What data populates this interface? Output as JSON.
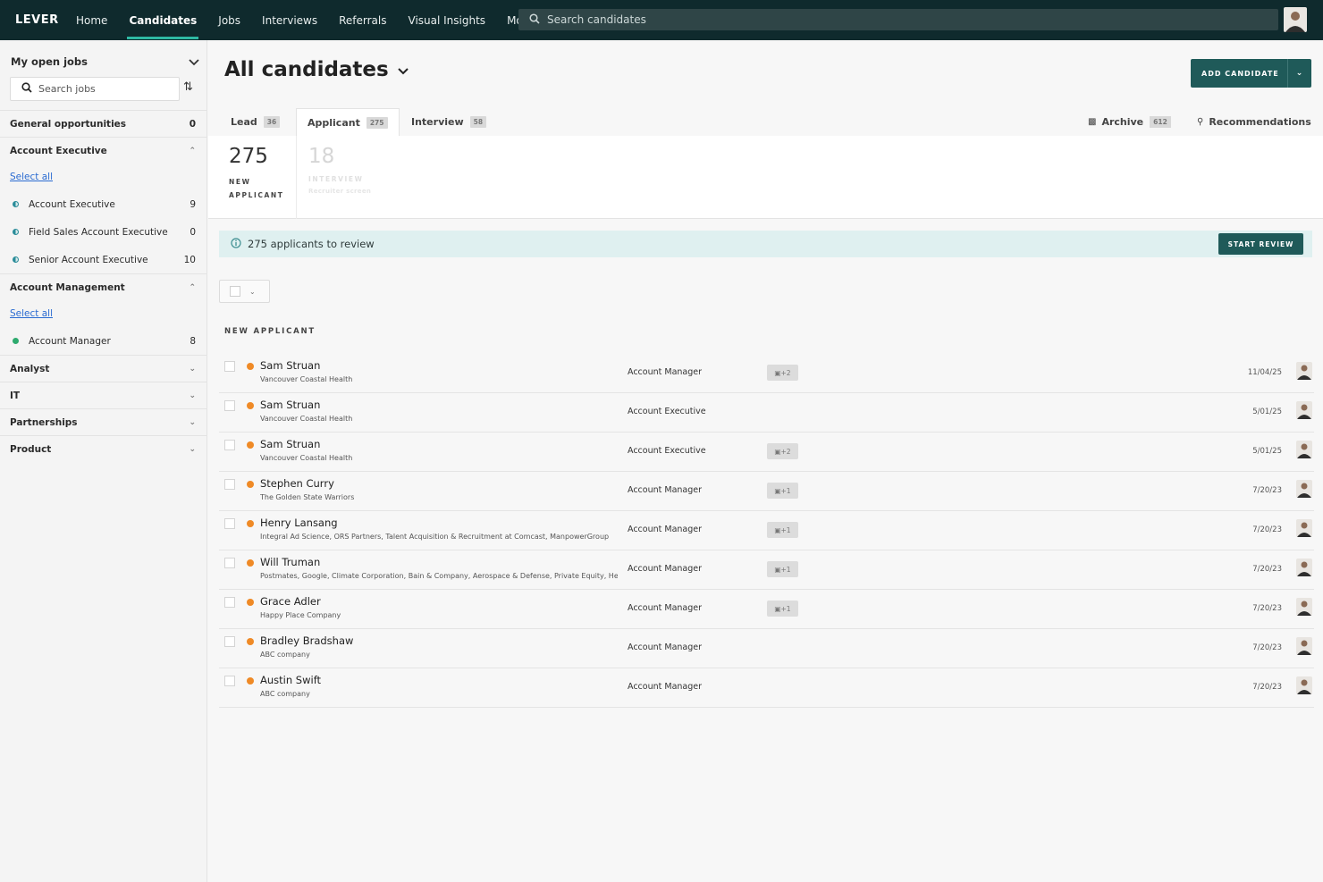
{
  "nav": {
    "logo": "LEVER",
    "items": [
      {
        "label": "Home",
        "active": false
      },
      {
        "label": "Candidates",
        "active": true
      },
      {
        "label": "Jobs",
        "active": false
      },
      {
        "label": "Interviews",
        "active": false
      },
      {
        "label": "Referrals",
        "active": false
      },
      {
        "label": "Visual Insights",
        "active": false
      },
      {
        "label": "More",
        "active": false
      }
    ],
    "search_placeholder": "Search candidates"
  },
  "sidebar": {
    "title": "My open jobs",
    "search_placeholder": "Search jobs",
    "groups": [
      {
        "label": "General opportunities",
        "count": "0",
        "type": "count"
      },
      {
        "label": "Account Executive",
        "type": "expanded",
        "select_all": "Select all",
        "jobs": [
          {
            "label": "Account Executive",
            "count": "9",
            "dot": "half"
          },
          {
            "label": "Field Sales Account Executive",
            "count": "0",
            "dot": "half"
          },
          {
            "label": "Senior Account Executive",
            "count": "10",
            "dot": "half"
          }
        ]
      },
      {
        "label": "Account Management",
        "type": "expanded",
        "select_all": "Select all",
        "jobs": [
          {
            "label": "Account Manager",
            "count": "8",
            "dot": "green"
          }
        ]
      },
      {
        "label": "Analyst",
        "type": "collapsed"
      },
      {
        "label": "IT",
        "type": "collapsed"
      },
      {
        "label": "Partnerships",
        "type": "collapsed"
      },
      {
        "label": "Product",
        "type": "collapsed"
      }
    ]
  },
  "main": {
    "title": "All candidates",
    "add_candidate": "ADD CANDIDATE",
    "tabs": [
      {
        "label": "Lead",
        "count": "36"
      },
      {
        "label": "Applicant",
        "count": "275"
      },
      {
        "label": "Interview",
        "count": "58"
      }
    ],
    "archive": {
      "label": "Archive",
      "count": "612"
    },
    "recommendations": "Recommendations",
    "stages": [
      {
        "num": "275",
        "line1": "NEW",
        "line2": "APPLICANT"
      },
      {
        "num": "18",
        "line1": "INTERVIEW",
        "line2": "Recruiter screen"
      }
    ],
    "banner": "275 applicants to review",
    "start_review": "START REVIEW",
    "section": "NEW APPLICANT",
    "candidates": [
      {
        "name": "Sam Struan",
        "org": "Vancouver Coastal Health",
        "position": "Account Manager",
        "badge": "+2",
        "date": "11/04/25"
      },
      {
        "name": "Sam Struan",
        "org": "Vancouver Coastal Health",
        "position": "Account Executive",
        "badge": "",
        "date": "5/01/25"
      },
      {
        "name": "Sam Struan",
        "org": "Vancouver Coastal Health",
        "position": "Account Executive",
        "badge": "+2",
        "date": "5/01/25"
      },
      {
        "name": "Stephen Curry",
        "org": "The Golden State Warriors",
        "position": "Account Manager",
        "badge": "+1",
        "date": "7/20/23"
      },
      {
        "name": "Henry Lansang",
        "org": "Integral Ad Science, ORS Partners, Talent Acquisition & Recruitment at Comcast, ManpowerGroup",
        "position": "Account Manager",
        "badge": "+1",
        "date": "7/20/23"
      },
      {
        "name": "Will Truman",
        "org": "Postmates, Google, Climate Corporation, Bain & Company, Aerospace & Defense, Private Equity, He...",
        "position": "Account Manager",
        "badge": "+1",
        "date": "7/20/23"
      },
      {
        "name": "Grace Adler",
        "org": "Happy Place Company",
        "position": "Account Manager",
        "badge": "+1",
        "date": "7/20/23"
      },
      {
        "name": "Bradley Bradshaw",
        "org": "ABC company",
        "position": "Account Manager",
        "badge": "",
        "date": "7/20/23"
      },
      {
        "name": "Austin Swift",
        "org": "ABC company",
        "position": "Account Manager",
        "badge": "",
        "date": "7/20/23"
      }
    ]
  },
  "colors": {
    "nav_bg": "#0f2a2d",
    "accent": "#1f5a59",
    "banner_bg": "#dff0f0",
    "status_dot": "#ef8a26"
  }
}
